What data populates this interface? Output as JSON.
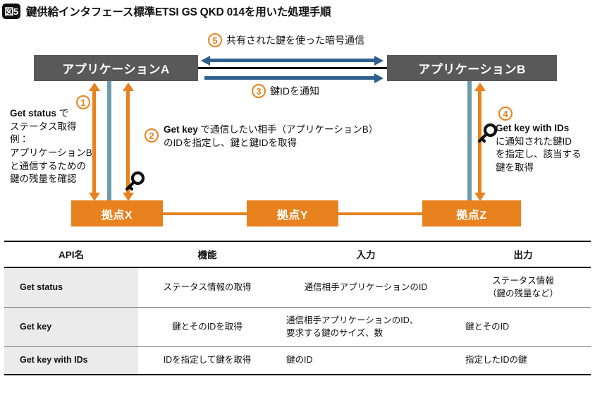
{
  "title": {
    "badge": "図5",
    "text": "鍵供給インタフェース標準ETSI GS QKD 014を用いた処理手順"
  },
  "colors": {
    "orange": "#E8821E",
    "teal": "#6E9BAA",
    "blue": "#2E5F8F",
    "app_box_gray": "#595959",
    "table_first_col_gray": "#EBEBEB",
    "black": "#111111"
  },
  "diagram": {
    "app_a": "アプリケーションA",
    "app_b": "アプリケーションB",
    "node_x": "拠点X",
    "node_y": "拠点Y",
    "node_z": "拠点Z",
    "steps": {
      "s1": "①",
      "s2": "②",
      "s3": "③",
      "s4": "④",
      "s5": "⑤"
    },
    "step_numbers": {
      "n1": "1",
      "n2": "2",
      "n3": "3",
      "n4": "4",
      "n5": "5"
    },
    "label_5": "共有された鍵を使った暗号通信",
    "label_3": "鍵IDを通知",
    "desc_1": {
      "api": "Get status",
      "line1": " で",
      "line2": "ステータス取得",
      "line3": "例：",
      "line4": "アプリケーションB",
      "line5": "と通信するための",
      "line6": "鍵の残量を確認"
    },
    "desc_2": {
      "api": "Get key",
      "line1": " で通信したい相手（アプリケーションB）",
      "line2": "のIDを指定し、鍵と鍵IDを取得"
    },
    "desc_4": {
      "api": "Get key with IDs",
      "line1": "に通知された鍵ID",
      "line2": "を指定し、該当する",
      "line3": "鍵を取得"
    },
    "icons": {
      "key": "key-icon"
    }
  },
  "table": {
    "headers": [
      "API名",
      "機能",
      "入力",
      "出力"
    ],
    "rows": [
      {
        "api": "Get status",
        "function": "ステータス情報の取得",
        "input": "通信相手アプリケーションのID",
        "output_line1": "ステータス情報",
        "output_line2": "（鍵の残量など）"
      },
      {
        "api": "Get key",
        "function": "鍵とそのIDを取得",
        "input_line1": "通信相手アプリケーションのID、",
        "input_line2": "要求する鍵のサイズ、数",
        "output_line1": "鍵とそのID",
        "output_line2": ""
      },
      {
        "api": "Get key with IDs",
        "function": "IDを指定して鍵を取得",
        "input_line1": "鍵のID",
        "input_line2": "",
        "output_line1": "指定したIDの鍵",
        "output_line2": ""
      }
    ]
  }
}
